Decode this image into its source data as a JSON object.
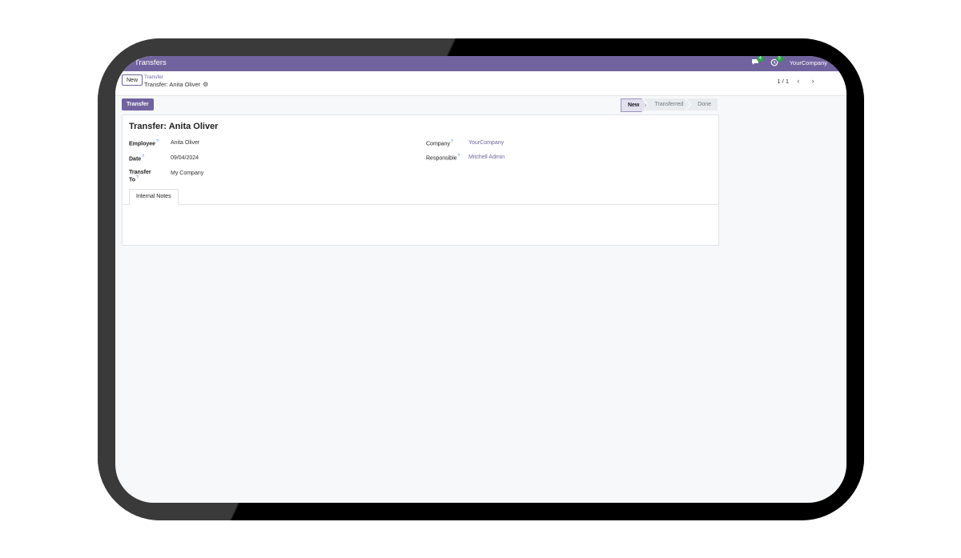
{
  "navbar": {
    "app_title": "Transfers",
    "messages_badge": "4",
    "activities_badge": "5",
    "company": "YourCompany"
  },
  "control_panel": {
    "new_label": "New",
    "breadcrumb_parent": "Transfer",
    "breadcrumb_current": "Transfer: Anita Oliver",
    "pager_value": "1 / 1"
  },
  "statusbar": {
    "action_label": "Transfer",
    "stages": [
      {
        "label": "New",
        "active": true
      },
      {
        "label": "Transferred",
        "active": false
      },
      {
        "label": "Done",
        "active": false
      }
    ]
  },
  "form": {
    "title": "Transfer: Anita Oliver",
    "fields": {
      "employee": {
        "label": "Employee",
        "value": "Anita Oliver"
      },
      "date": {
        "label": "Date",
        "value": "09/04/2024"
      },
      "transfer_to": {
        "label": "Transfer To",
        "value": "My Company"
      },
      "company": {
        "label": "Company",
        "value": "YourCompany"
      },
      "responsible": {
        "label": "Responsible",
        "value": "Mitchell Admin"
      }
    },
    "tooltip_marker": "?",
    "tab_label": "Internal Notes"
  },
  "colors": {
    "brand": "#71639e",
    "badge": "#28a745",
    "link": "#71639e"
  },
  "icons": {
    "messages": "chat-bubble-icon",
    "activities": "clock-icon",
    "record_settings": "gear-icon",
    "pager_prev": "chevron-left-icon",
    "pager_next": "chevron-right-icon"
  }
}
